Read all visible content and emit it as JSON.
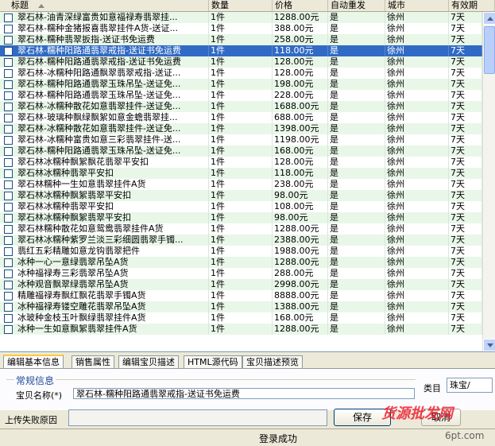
{
  "columns": {
    "title": "标题",
    "qty": "数量",
    "price": "价格",
    "auto": "自动重发",
    "city": "城市",
    "valid": "有效期"
  },
  "rows": [
    {
      "title": "翠石林-油青深绿富贵如意福禄寿翡翠挂...",
      "qty": "1件",
      "price": "1288.00元",
      "auto": "是",
      "city": "徐州",
      "valid": "7天"
    },
    {
      "title": "翠石林-糯种金猪报喜翡翠挂件A货-送证...",
      "qty": "1件",
      "price": "388.00元",
      "auto": "是",
      "city": "徐州",
      "valid": "7天"
    },
    {
      "title": "翠石林-糯种翡翠扳指-送证书免运费",
      "qty": "1件",
      "price": "258.00元",
      "auto": "是",
      "city": "徐州",
      "valid": "7天"
    },
    {
      "title": "翠石林-糯种阳路通翡翠戒指-送证书免运费",
      "qty": "1件",
      "price": "118.00元",
      "auto": "是",
      "city": "徐州",
      "valid": "7天"
    },
    {
      "title": "翠石林-糯种阳路通翡翠戒指-送证书免运费",
      "qty": "1件",
      "price": "128.00元",
      "auto": "是",
      "city": "徐州",
      "valid": "7天"
    },
    {
      "title": "翠石林-冰糯种阳路通飘翠翡翠戒指-送证...",
      "qty": "1件",
      "price": "128.00元",
      "auto": "是",
      "city": "徐州",
      "valid": "7天"
    },
    {
      "title": "翠石林-糯种阳路通翡翠玉珠吊坠-送证免...",
      "qty": "1件",
      "price": "198.00元",
      "auto": "是",
      "city": "徐州",
      "valid": "7天"
    },
    {
      "title": "翠石林-糯种阳路通翡翠玉珠吊坠-送证免...",
      "qty": "1件",
      "price": "228.00元",
      "auto": "是",
      "city": "徐州",
      "valid": "7天"
    },
    {
      "title": "翠石林-冰糯种散花如意翡翠挂件-送证免...",
      "qty": "1件",
      "price": "1688.00元",
      "auto": "是",
      "city": "徐州",
      "valid": "7天"
    },
    {
      "title": "翠石林-玻璃种飘绿飘絮如意金蟾翡翠挂...",
      "qty": "1件",
      "price": "688.00元",
      "auto": "是",
      "city": "徐州",
      "valid": "7天"
    },
    {
      "title": "翠石林-冰糯种散花如意翡翠挂件-送证免...",
      "qty": "1件",
      "price": "1398.00元",
      "auto": "是",
      "city": "徐州",
      "valid": "7天"
    },
    {
      "title": "翠石林-冰糯种富贵如意三彩翡翠挂件-送...",
      "qty": "1件",
      "price": "1198.00元",
      "auto": "是",
      "city": "徐州",
      "valid": "7天"
    },
    {
      "title": "翠石林-糯种阳路通翡翠玉珠吊坠-送证免...",
      "qty": "1件",
      "price": "168.00元",
      "auto": "是",
      "city": "徐州",
      "valid": "7天"
    },
    {
      "title": "翠石林冰糯种飘絮飘花翡翠平安扣",
      "qty": "1件",
      "price": "128.00元",
      "auto": "是",
      "city": "徐州",
      "valid": "7天"
    },
    {
      "title": "翠石林冰糯种翡翠平安扣",
      "qty": "1件",
      "price": "118.00元",
      "auto": "是",
      "city": "徐州",
      "valid": "7天"
    },
    {
      "title": "翠石林糯种一生如意翡翠挂件A货",
      "qty": "1件",
      "price": "238.00元",
      "auto": "是",
      "city": "徐州",
      "valid": "7天"
    },
    {
      "title": "翠石林冰糯种飘絮翡翠平安扣",
      "qty": "1件",
      "price": "98.00元",
      "auto": "是",
      "city": "徐州",
      "valid": "7天"
    },
    {
      "title": "翠石林冰糯种翡翠平安扣",
      "qty": "1件",
      "price": "108.00元",
      "auto": "是",
      "city": "徐州",
      "valid": "7天"
    },
    {
      "title": "翠石林冰糯种飘絮翡翠平安扣",
      "qty": "1件",
      "price": "98.00元",
      "auto": "是",
      "city": "徐州",
      "valid": "7天"
    },
    {
      "title": "翠石林糯种散花如意鸳鸯翡翠挂件A货",
      "qty": "1件",
      "price": "1288.00元",
      "auto": "是",
      "city": "徐州",
      "valid": "7天"
    },
    {
      "title": "翠石林冰糯种紫罗兰淡三彩细圆翡翠手镯...",
      "qty": "1件",
      "price": "2388.00元",
      "auto": "是",
      "city": "徐州",
      "valid": "7天"
    },
    {
      "title": "翡红五彩精雕如意龙钩翡翠把件",
      "qty": "1件",
      "price": "1988.00元",
      "auto": "是",
      "city": "徐州",
      "valid": "7天"
    },
    {
      "title": "冰种一心一意绿翡翠吊坠A货",
      "qty": "1件",
      "price": "1288.00元",
      "auto": "是",
      "city": "徐州",
      "valid": "7天"
    },
    {
      "title": "冰种福禄寿三彩翡翠吊坠A货",
      "qty": "1件",
      "price": "288.00元",
      "auto": "是",
      "city": "徐州",
      "valid": "7天"
    },
    {
      "title": "冰种观音飘翠绿翡翠吊坠A货",
      "qty": "1件",
      "price": "2998.00元",
      "auto": "是",
      "city": "徐州",
      "valid": "7天"
    },
    {
      "title": "精雕福禄寿飘红飘花翡翠手镯A货",
      "qty": "1件",
      "price": "8888.00元",
      "auto": "是",
      "city": "徐州",
      "valid": "7天"
    },
    {
      "title": "冰种福禄寿镂空雕花翡翠吊坠A货",
      "qty": "1件",
      "price": "1388.00元",
      "auto": "是",
      "city": "徐州",
      "valid": "7天"
    },
    {
      "title": "冰玻种金枝玉叶飘绿翡翠挂件A货",
      "qty": "1件",
      "price": "168.00元",
      "auto": "是",
      "city": "徐州",
      "valid": "7天"
    },
    {
      "title": "冰种一生如意飘絮翡翠挂件A货",
      "qty": "1件",
      "price": "1288.00元",
      "auto": "是",
      "city": "徐州",
      "valid": "7天"
    }
  ],
  "selected_row": 3,
  "tabs": [
    "编辑基本信息",
    "销售属性",
    "编辑宝贝描述",
    "HTML源代码",
    "宝贝描述预览"
  ],
  "active_tab": 0,
  "panel": {
    "group_title": "常规信息",
    "baobei_label": "宝贝名称(*)",
    "baobei_value": "翠石林-糯种阳路通翡翠戒指-送证书免运费",
    "category_label": "类目",
    "category_value": "珠宝/"
  },
  "fail_reason_label": "上传失败原因",
  "save_button": "保存",
  "cancel_button": "取消",
  "status_text": "登录成功",
  "watermark_text": "货源批发网",
  "watermark_url": "6pt.com",
  "colors": {
    "row_alt": "#e8f7e8",
    "selected": "#316ac5",
    "tab_accent": "#ffc83c",
    "watermark": "#e23333"
  },
  "icons": {
    "sort": "sort-ascending-icon",
    "scroll_up": "scroll-up-icon",
    "scroll_down": "scroll-down-icon"
  }
}
